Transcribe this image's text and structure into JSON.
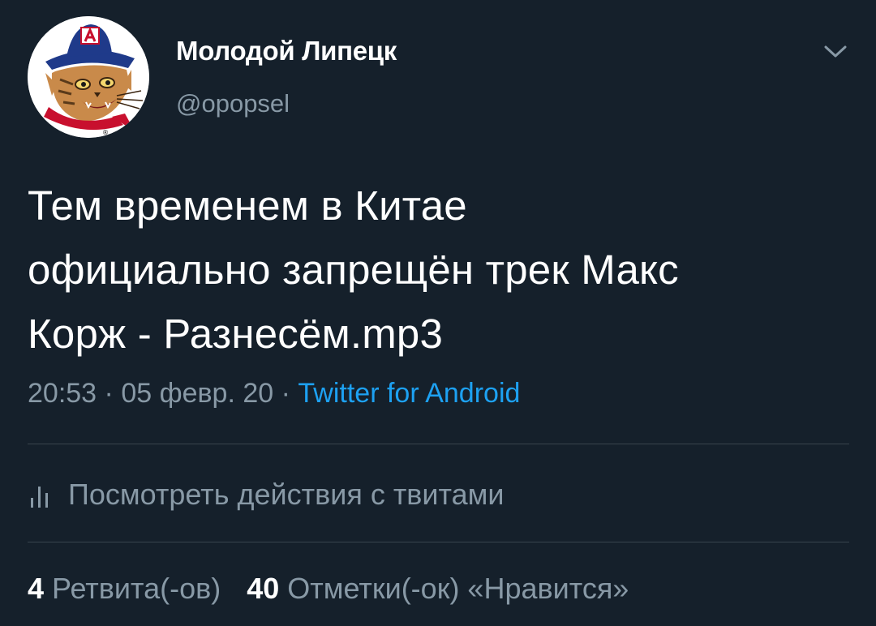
{
  "user": {
    "display_name": "Молодой Липецк",
    "handle": "@opopsel",
    "avatar_icon": "wildcat-mascot-avatar"
  },
  "tweet": {
    "lines": [
      "Тем временем в Китае",
      "официально запрещён трек Макс",
      "Корж - Разнесём.mp3"
    ],
    "time": "20:53",
    "separator": "·",
    "date": "05 февр. 20",
    "source": "Twitter for Android"
  },
  "activity": {
    "icon": "bar-chart-icon",
    "label": "Посмотреть действия с твитами"
  },
  "stats": {
    "retweets_count": "4",
    "retweets_label": "Ретвита(-ов)",
    "likes_count": "40",
    "likes_label": "Отметки(-ок) «Нравится»"
  },
  "colors": {
    "background": "#15202b",
    "text": "#ffffff",
    "secondary": "#8899a6",
    "link": "#1da1f2",
    "divider": "#38444d"
  }
}
